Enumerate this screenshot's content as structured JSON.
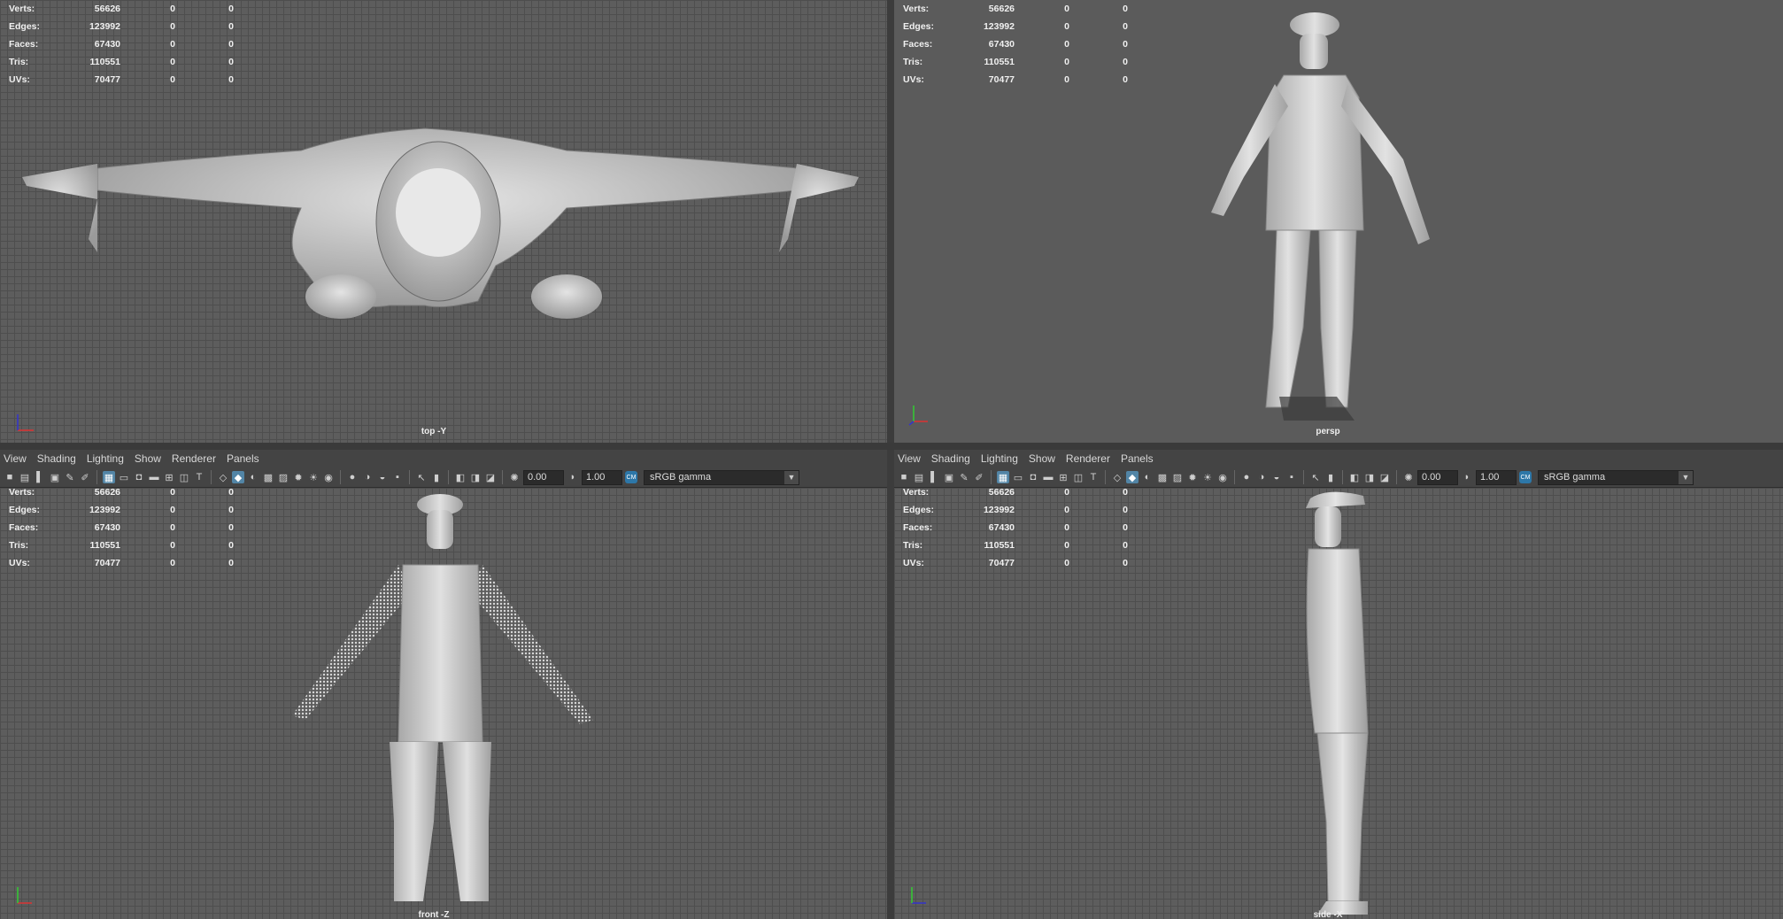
{
  "menu": [
    "View",
    "Shading",
    "Lighting",
    "Show",
    "Renderer",
    "Panels"
  ],
  "toolbar": {
    "exposure": "0.00",
    "gamma": "1.00",
    "color_space": "sRGB gamma"
  },
  "hud": {
    "labels": [
      "Verts:",
      "Edges:",
      "Faces:",
      "Tris:",
      "UVs:"
    ],
    "values": [
      [
        "56626",
        "0",
        "0"
      ],
      [
        "123992",
        "0",
        "0"
      ],
      [
        "67430",
        "0",
        "0"
      ],
      [
        "110551",
        "0",
        "0"
      ],
      [
        "70477",
        "0",
        "0"
      ]
    ]
  },
  "viewports": {
    "top": {
      "camera": "top -Y"
    },
    "persp": {
      "camera": "persp"
    },
    "front": {
      "camera": "front -Z"
    },
    "side": {
      "camera": "side -X"
    }
  },
  "colors": {
    "grid_bg": "#5d5d5d",
    "persp_bg": "#5b5b5b",
    "toolbar_bg": "#444444",
    "active_icon": "#5285a6",
    "model": "#c9c9c9"
  },
  "icons": {
    "axis_x": "x-axis-red",
    "axis_y": "y-axis-green",
    "axis_z": "z-axis-blue"
  }
}
